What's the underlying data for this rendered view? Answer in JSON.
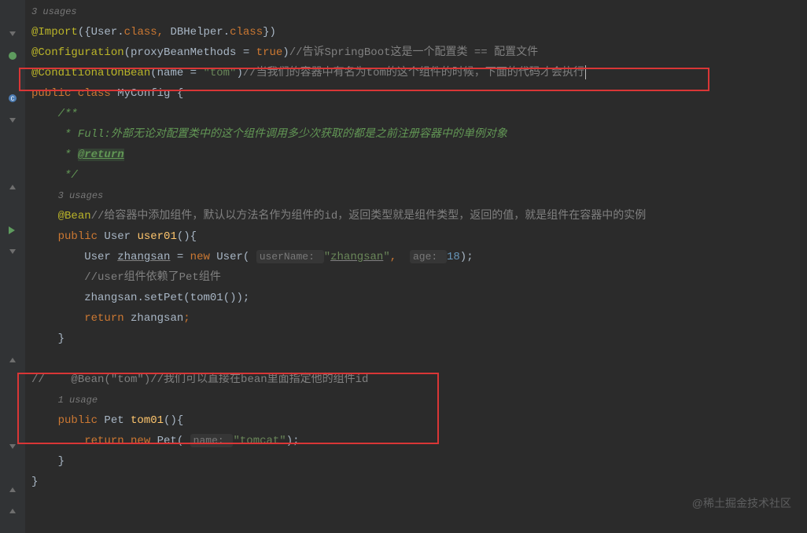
{
  "usages": {
    "top": "3 usages",
    "bean": "3 usages",
    "tom": "1 usage"
  },
  "code": {
    "import_at": "@Import",
    "import_paren_open": "({",
    "import_user": "User",
    "import_dot": ".",
    "import_class": "class",
    "import_comma": ", ",
    "import_db": "DBHelper",
    "import_paren_close": "})",
    "config_at": "@Configuration",
    "config_open": "(",
    "config_proxy": "proxyBeanMethods = ",
    "config_true": "true",
    "config_close": ")",
    "config_comment": "//告诉SpringBoot这是一个配置类 == 配置文件",
    "cond_at": "@ConditionalOnBean",
    "cond_open": "(",
    "cond_name": "name = ",
    "cond_tom": "\"tom\"",
    "cond_close": ")",
    "cond_comment": "//当我们的容器中有名为tom的这个组件的时候，下面的代码才会执行",
    "pub_class": "public class",
    "myconfig": " MyConfig ",
    "brace_open": "{",
    "javadoc_open": "/**",
    "javadoc_full": " * Full:",
    "javadoc_full_text": "外部无论对配置类中的这个组件调用多少次获取的都是之前注册容器中的单例对象",
    "javadoc_return_prefix": " * ",
    "javadoc_return": "@return",
    "javadoc_close": " */",
    "bean_at": "@Bean",
    "bean_comment": "//给容器中添加组件，默认以方法名作为组件的id，返回类型就是组件类型，返回的值，就是组件在容器中的实例",
    "pub": "public ",
    "user_type": "User ",
    "user01": "user01",
    "method_open": "(){",
    "user_var": "User ",
    "zhangsan": "zhangsan",
    "eq": " = ",
    "new_kw": "new ",
    "user_ctor": "User",
    "ctor_open": "( ",
    "hint_username": "userName: ",
    "str_zhangsan": "\"",
    "str_zhangsan_val": "zhangsan",
    "str_zhangsan_end": "\"",
    "ctor_comma": ",  ",
    "hint_age": "age: ",
    "num_18": "18",
    "ctor_close": ");",
    "user_dep_comment": "//user组件依赖了Pet组件",
    "setpet_obj": "zhangsan",
    "setpet_dot": ".",
    "setpet": "setPet",
    "setpet_open": "(",
    "tom01_call": "tom01",
    "setpet_close": "());",
    "ret": "return ",
    "ret_zhangsan": "zhangsan",
    "ret_semi": ";",
    "brace_close": "}",
    "slash": "//",
    "bean_tom": "@Bean(\"tom\")",
    "bean_tom_comment": "//我们可以直接在bean里面指定他的组件id",
    "pet_type": "Pet ",
    "tom01": "tom01",
    "new_pet": "Pet",
    "hint_name": "name: ",
    "str_tomcat": "\"tomcat\"",
    "pet_close": ");"
  },
  "watermark": "@稀土掘金技术社区"
}
